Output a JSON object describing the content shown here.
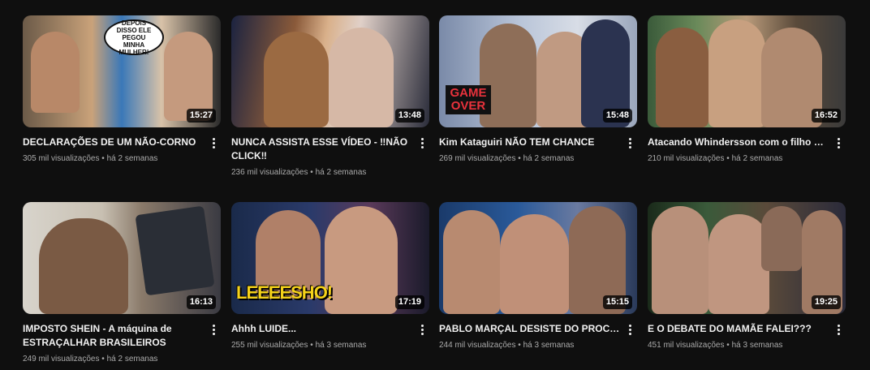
{
  "videos": [
    {
      "title": "DECLARAÇÕES DE UM NÃO-CORNO",
      "views": "305 mil visualizações",
      "age": "há 2 semanas",
      "duration": "15:27",
      "thumb_text": "DEPOIS DISSO ELE PEGOU MINHA MULHER!"
    },
    {
      "title": "NUNCA ASSISTA ESSE VÍDEO - ‼NÃO CLICK‼",
      "views": "236 mil visualizações",
      "age": "há 2 semanas",
      "duration": "13:48"
    },
    {
      "title": "Kim Kataguiri NÃO TEM CHANCE",
      "views": "269 mil visualizações",
      "age": "há 2 semanas",
      "duration": "15:48",
      "thumb_text": "GAME OVER"
    },
    {
      "title": "Atacando Whindersson com o filho morto...",
      "views": "210 mil visualizações",
      "age": "há 2 semanas",
      "duration": "16:52"
    },
    {
      "title": "IMPOSTO SHEIN - A máquina de ESTRAÇALHAR BRASILEIROS",
      "views": "249 mil visualizações",
      "age": "há 2 semanas",
      "duration": "16:13"
    },
    {
      "title": "Ahhh LUIDE...",
      "views": "255 mil visualizações",
      "age": "há 3 semanas",
      "duration": "17:19",
      "thumb_text": "LEEEESHO!"
    },
    {
      "title": "PABLO MARÇAL DESISTE DO PROCESSO",
      "views": "244 mil visualizações",
      "age": "há 3 semanas",
      "duration": "15:15"
    },
    {
      "title": "E O DEBATE DO MAMÃE FALEI???",
      "views": "451 mil visualizações",
      "age": "há 3 semanas",
      "duration": "19:25"
    }
  ],
  "separator": "•"
}
